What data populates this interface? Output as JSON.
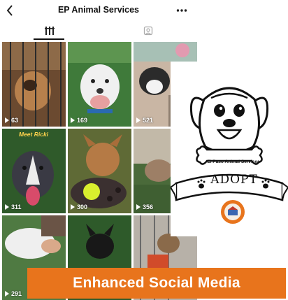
{
  "header": {
    "back_icon": "chevron-left-icon",
    "title": "EP Animal Services",
    "more_icon": "more-horizontal-icon"
  },
  "tabs": [
    {
      "icon": "grid-icon",
      "active": true
    },
    {
      "icon": "tagged-icon",
      "active": false
    }
  ],
  "grid": {
    "tiles": [
      {
        "views": "63",
        "caption": "",
        "colors": [
          "#7a5a3c",
          "#4a3422",
          "#c79a6a"
        ]
      },
      {
        "views": "169",
        "caption": "",
        "colors": [
          "#3f7a3a",
          "#e9e9e9",
          "#8a5d4a"
        ]
      },
      {
        "views": "521",
        "caption": "",
        "colors": [
          "#d9c6b6",
          "#2b2b2b",
          "#a7c0b5"
        ]
      },
      {
        "views": "311",
        "caption": "Meet Ricki",
        "colors": [
          "#2f5a2a",
          "#3a3a44",
          "#e7e1dc"
        ]
      },
      {
        "views": "300",
        "caption": "",
        "colors": [
          "#6a6f3a",
          "#b57a45",
          "#3b3030"
        ]
      },
      {
        "views": "356",
        "caption": "",
        "colors": [
          "#4a6a3a",
          "#9d7f66",
          "#c2b9a8"
        ]
      },
      {
        "views": "291",
        "caption": "",
        "colors": [
          "#4f7a42",
          "#efefef",
          "#6a5446"
        ]
      },
      {
        "views": "",
        "caption": "",
        "colors": [
          "#2e5a2a",
          "#181818",
          "#5d7a4f"
        ]
      },
      {
        "views": "",
        "caption": "",
        "colors": [
          "#b7b1a8",
          "#d14b2a",
          "#8a6a4a"
        ]
      }
    ]
  },
  "logo": {
    "org_name": "El Paso Animal Services",
    "adopt_text": "ADOPT",
    "seal_icon": "city-seal-icon"
  },
  "banner": {
    "text": "Enhanced Social Media",
    "color": "#e8741c"
  }
}
